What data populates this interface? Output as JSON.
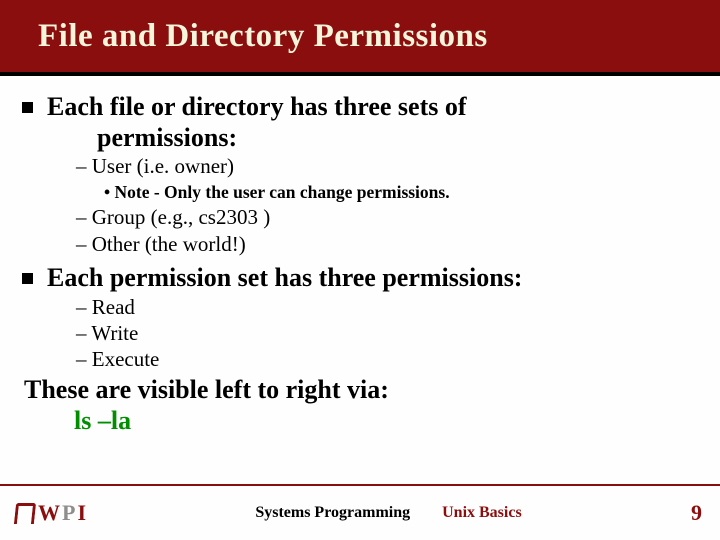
{
  "title": "File and Directory Permissions",
  "b1a_l1": "Each file or directory has three sets of",
  "b1a_l2": "permissions:",
  "s1a": "– User (i.e. owner)",
  "s1a_note": "• Note - Only the user can change permissions.",
  "s1b": "– Group (e.g., cs2303 )",
  "s1c": "– Other (the world!)",
  "b1b": "Each permission set has three permissions:",
  "s2a": "– Read",
  "s2b": "– Write",
  "s2c": "– Execute",
  "outro_l1": "These are visible left to right via:",
  "outro_cmd": "ls –la",
  "logo_w": "W",
  "logo_p": "P",
  "logo_i": "I",
  "foot_sp": "Systems Programming",
  "foot_ub": "Unix Basics",
  "pagenum": "9"
}
